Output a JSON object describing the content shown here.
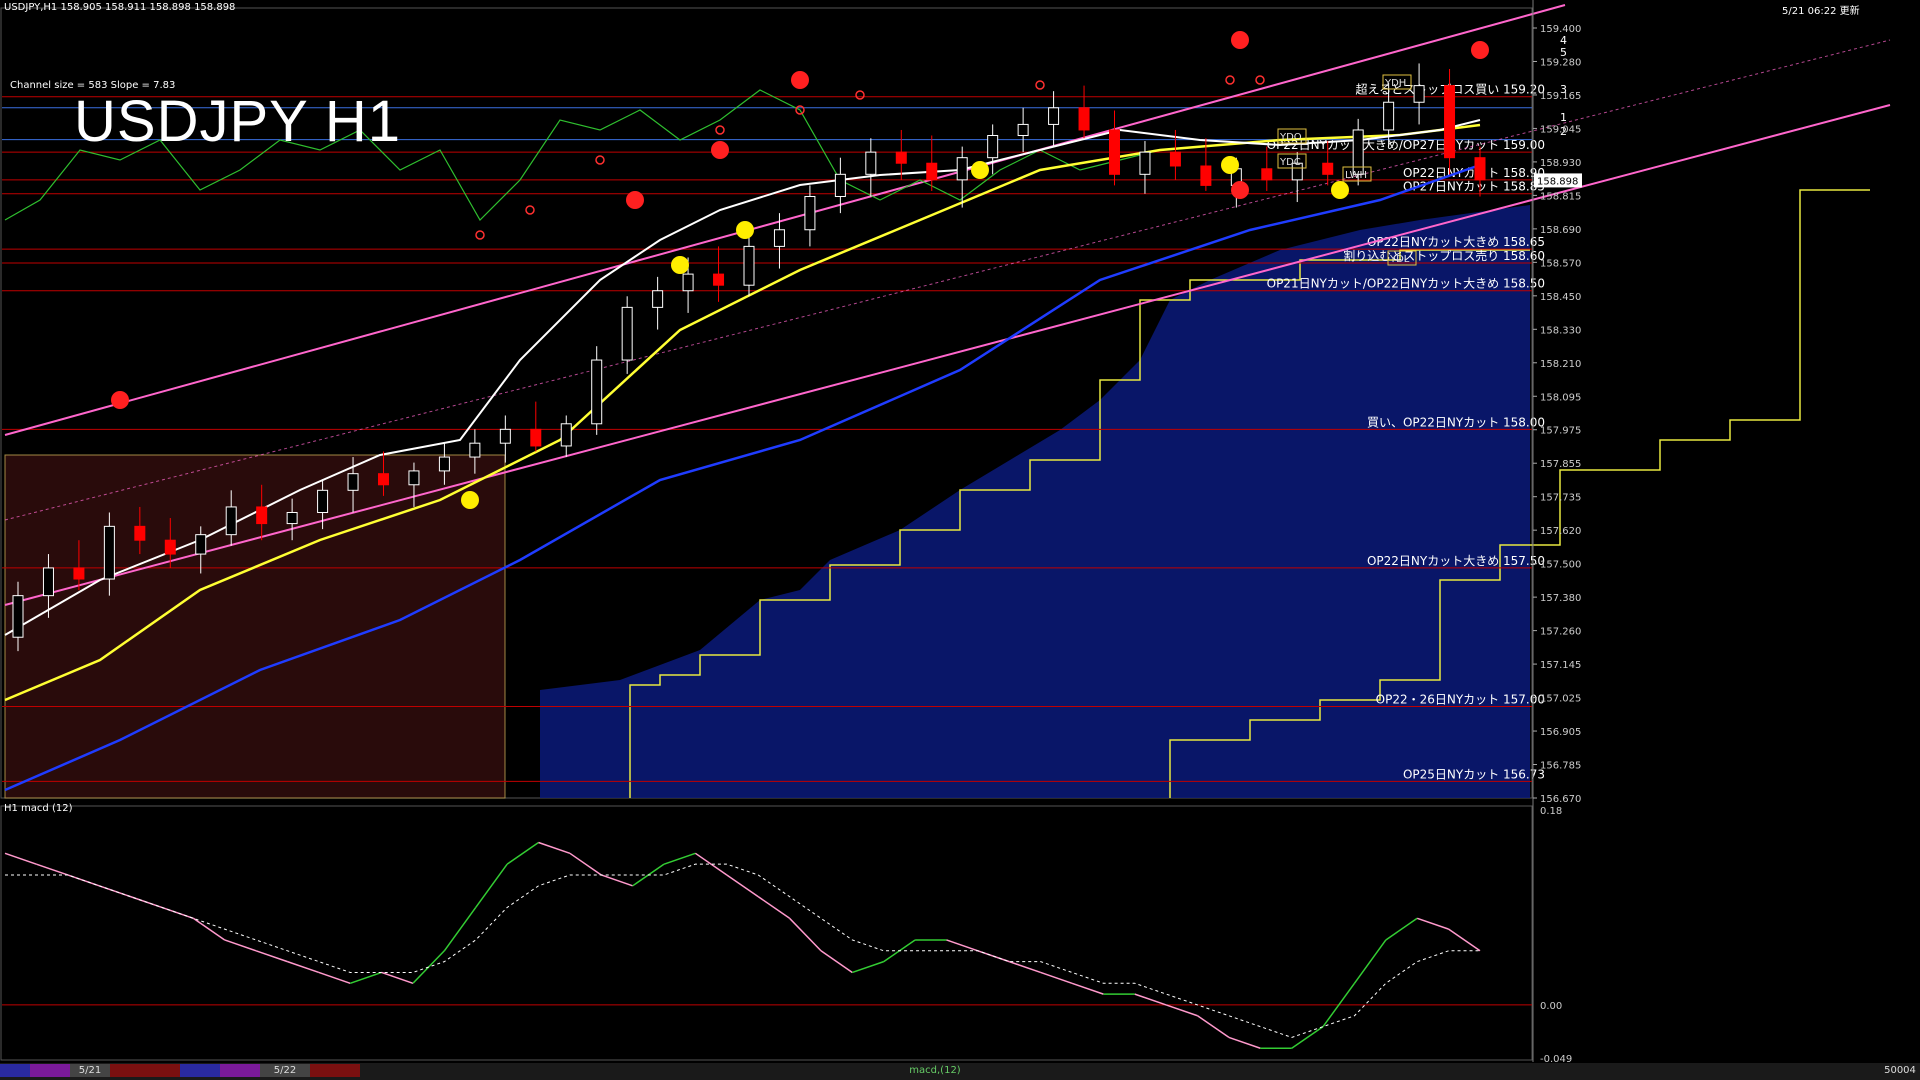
{
  "header": {
    "symbol_info": "USDJPY,H1  158.905 158.911 158.898 158.898",
    "datetime": "5/21 06:22 更新",
    "channel_info": "Channel size = 583 Slope = 7.83",
    "big_title": "USDJPY H1"
  },
  "chart_data": [
    {
      "type": "candlestick",
      "title": "USDJPY H1",
      "ylim": [
        156.67,
        159.52
      ],
      "y_ticks": [
        "159.400",
        "159.280",
        "159.165",
        "159.045",
        "158.930",
        "158.815",
        "158.690",
        "158.570",
        "158.450",
        "158.330",
        "158.210",
        "158.095",
        "157.975",
        "157.855",
        "157.735",
        "157.620",
        "157.500",
        "157.380",
        "157.260",
        "157.145",
        "157.025",
        "156.905",
        "156.785",
        "156.670"
      ],
      "current_price": "158.898",
      "candles_ohlc": [
        [
          157.25,
          157.45,
          157.2,
          157.4
        ],
        [
          157.4,
          157.55,
          157.32,
          157.5
        ],
        [
          157.5,
          157.6,
          157.42,
          157.46
        ],
        [
          157.46,
          157.7,
          157.4,
          157.65
        ],
        [
          157.65,
          157.72,
          157.55,
          157.6
        ],
        [
          157.6,
          157.68,
          157.5,
          157.55
        ],
        [
          157.55,
          157.65,
          157.48,
          157.62
        ],
        [
          157.62,
          157.78,
          157.58,
          157.72
        ],
        [
          157.72,
          157.8,
          157.6,
          157.66
        ],
        [
          157.66,
          157.75,
          157.6,
          157.7
        ],
        [
          157.7,
          157.82,
          157.64,
          157.78
        ],
        [
          157.78,
          157.9,
          157.7,
          157.84
        ],
        [
          157.84,
          157.92,
          157.76,
          157.8
        ],
        [
          157.8,
          157.88,
          157.72,
          157.85
        ],
        [
          157.85,
          157.95,
          157.8,
          157.9
        ],
        [
          157.9,
          158.0,
          157.84,
          157.95
        ],
        [
          157.95,
          158.05,
          157.88,
          158.0
        ],
        [
          158.0,
          158.1,
          157.92,
          157.94
        ],
        [
          157.94,
          158.05,
          157.9,
          158.02
        ],
        [
          158.02,
          158.3,
          157.98,
          158.25
        ],
        [
          158.25,
          158.48,
          158.2,
          158.44
        ],
        [
          158.44,
          158.55,
          158.36,
          158.5
        ],
        [
          158.5,
          158.62,
          158.42,
          158.56
        ],
        [
          158.56,
          158.66,
          158.46,
          158.52
        ],
        [
          158.52,
          158.7,
          158.48,
          158.66
        ],
        [
          158.66,
          158.78,
          158.58,
          158.72
        ],
        [
          158.72,
          158.88,
          158.66,
          158.84
        ],
        [
          158.84,
          158.98,
          158.78,
          158.92
        ],
        [
          158.92,
          159.05,
          158.84,
          159.0
        ],
        [
          159.0,
          159.08,
          158.9,
          158.96
        ],
        [
          158.96,
          159.06,
          158.86,
          158.9
        ],
        [
          158.9,
          159.02,
          158.8,
          158.98
        ],
        [
          158.98,
          159.1,
          158.92,
          159.06
        ],
        [
          159.06,
          159.16,
          159.0,
          159.1
        ],
        [
          159.1,
          159.22,
          159.02,
          159.16
        ],
        [
          159.16,
          159.24,
          159.05,
          159.08
        ],
        [
          159.08,
          159.15,
          158.88,
          158.92
        ],
        [
          158.92,
          159.04,
          158.85,
          159.0
        ],
        [
          159.0,
          159.08,
          158.9,
          158.95
        ],
        [
          158.95,
          159.05,
          158.86,
          158.88
        ],
        [
          158.88,
          158.98,
          158.8,
          158.94
        ],
        [
          158.94,
          159.02,
          158.86,
          158.9
        ],
        [
          158.9,
          159.0,
          158.82,
          158.96
        ],
        [
          158.96,
          159.04,
          158.88,
          158.92
        ],
        [
          158.92,
          159.12,
          158.88,
          159.08
        ],
        [
          159.08,
          159.25,
          159.02,
          159.18
        ],
        [
          159.18,
          159.32,
          159.1,
          159.24
        ],
        [
          159.24,
          159.3,
          158.92,
          158.98
        ],
        [
          158.98,
          159.02,
          158.84,
          158.9
        ]
      ]
    },
    {
      "type": "line",
      "title": "H1  macd (12)",
      "ylim": [
        -0.049,
        0.18
      ],
      "y_ticks": [
        "0.18",
        "0.00",
        "-0.049"
      ],
      "series": [
        {
          "values": [
            0.14,
            0.13,
            0.12,
            0.11,
            0.1,
            0.09,
            0.08,
            0.06,
            0.05,
            0.04,
            0.03,
            0.02,
            0.03,
            0.02,
            0.05,
            0.09,
            0.13,
            0.15,
            0.14,
            0.12,
            0.11,
            0.13,
            0.14,
            0.12,
            0.1,
            0.08,
            0.05,
            0.03,
            0.04,
            0.06,
            0.06,
            0.05,
            0.04,
            0.03,
            0.02,
            0.01,
            0.01,
            0.0,
            -0.01,
            -0.03,
            -0.04,
            -0.04,
            -0.02,
            0.02,
            0.06,
            0.08,
            0.07,
            0.05
          ]
        },
        {
          "values": [
            0.12,
            0.12,
            0.12,
            0.11,
            0.1,
            0.09,
            0.08,
            0.07,
            0.06,
            0.05,
            0.04,
            0.03,
            0.03,
            0.03,
            0.04,
            0.06,
            0.09,
            0.11,
            0.12,
            0.12,
            0.12,
            0.12,
            0.13,
            0.13,
            0.12,
            0.1,
            0.08,
            0.06,
            0.05,
            0.05,
            0.05,
            0.05,
            0.04,
            0.04,
            0.03,
            0.02,
            0.02,
            0.01,
            0.0,
            -0.01,
            -0.02,
            -0.03,
            -0.02,
            -0.01,
            0.02,
            0.04,
            0.05,
            0.05
          ]
        }
      ]
    }
  ],
  "levels": [
    {
      "text": "超えるとストップロス買い 159.20",
      "price": 159.2
    },
    {
      "text": "OP22日NYカット大きめ/OP27日NYカット 159.00",
      "price": 159.0
    },
    {
      "text": "OP22日NYカット 158.90",
      "price": 158.9
    },
    {
      "text": "OP27日NYカット 158.85",
      "price": 158.85
    },
    {
      "text": "OP22日NYカット大きめ 158.65",
      "price": 158.65
    },
    {
      "text": "割り込むとストップロス売り 158.60",
      "price": 158.6
    },
    {
      "text": "OP21日NYカット/OP22日NYカット大きめ 158.50",
      "price": 158.5
    },
    {
      "text": "買い、OP22日NYカット 158.00",
      "price": 158.0
    },
    {
      "text": "OP22日NYカット大きめ 157.50",
      "price": 157.5
    },
    {
      "text": "OP22・26日NYカット 157.00",
      "price": 157.0
    },
    {
      "text": "OP25日NYカット 156.73",
      "price": 156.73
    }
  ],
  "tags": [
    "YDH",
    "YDO",
    "YDC",
    "YDL",
    "LWH",
    "4",
    "5",
    "3",
    "1",
    "2"
  ],
  "bottom_tabs": [
    "5/21",
    "5/22",
    "macd,(12)",
    "50004"
  ],
  "colors": {
    "up": "#ffffff",
    "down": "#ff0000",
    "level": "#c00000",
    "channel": "#ff66cc",
    "sma_white": "#ffffff",
    "sma_yellow": "#ffff33",
    "sma_blue": "#1f3cff",
    "macd_line": "#ff99cc",
    "macd_up": "#33cc33",
    "cloud": "#0a1a7a",
    "green": "#2fbf2f",
    "hline_blue": "#3a6fdf"
  }
}
